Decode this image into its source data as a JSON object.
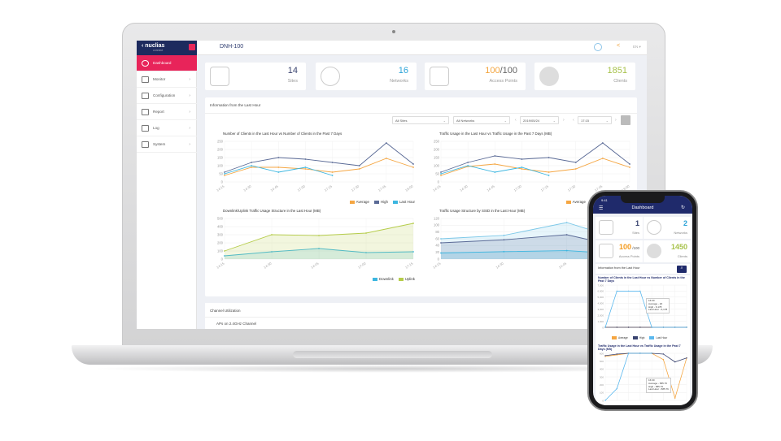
{
  "laptop": {
    "sidebar": {
      "brand": "nuclias",
      "brand_sub": "connect",
      "items": [
        {
          "label": "Dashboard",
          "icon": "dashboard-icon",
          "active": true
        },
        {
          "label": "Monitor",
          "icon": "monitor-icon"
        },
        {
          "label": "Configuration",
          "icon": "tools-icon"
        },
        {
          "label": "Report",
          "icon": "report-icon"
        },
        {
          "label": "Log",
          "icon": "log-icon"
        },
        {
          "label": "System",
          "icon": "system-icon"
        }
      ]
    },
    "header": {
      "device": "DNH-100",
      "lang": "EN ▾"
    },
    "stats": [
      {
        "value": "14",
        "label": "Sites",
        "color": "#3a4470"
      },
      {
        "value": "16",
        "label": "Networks",
        "color": "#2aa3d8"
      },
      {
        "value": "100",
        "total": "/100",
        "label": "Access Points",
        "color": "#f3a53e"
      },
      {
        "value": "1851",
        "label": "Clients",
        "color": "#a7c24a"
      }
    ],
    "panel": {
      "title": "Information from the Last Hour",
      "filters": {
        "site": "All Sites",
        "network": "All Networks",
        "date": "2019/05/24",
        "time": "17:15"
      }
    },
    "channel": {
      "title": "Channel Utilization",
      "subtitle": "APs on 2.4GHz Channel"
    }
  },
  "chart_data": [
    {
      "type": "line",
      "title": "Number of Clients in the Last Hour vs Number of Clients in the Past 7 Days",
      "categories": [
        "14:15",
        "14:30",
        "14:45",
        "17:00",
        "17:15",
        "17:30",
        "17:45",
        "18:00"
      ],
      "ylim": [
        0,
        250
      ],
      "yticks": [
        0,
        50,
        100,
        150,
        200,
        250
      ],
      "grid": true,
      "legend": "bottom-right",
      "series": [
        {
          "name": "Average",
          "color": "#f5a642",
          "values": [
            40,
            90,
            90,
            80,
            60,
            80,
            145,
            90
          ]
        },
        {
          "name": "High",
          "color": "#5a6a96",
          "values": [
            60,
            120,
            150,
            140,
            120,
            100,
            240,
            110
          ]
        },
        {
          "name": "Last Hour",
          "color": "#3cb6e0",
          "values": [
            50,
            100,
            60,
            90,
            40
          ]
        }
      ]
    },
    {
      "type": "line",
      "title": "Traffic Usage in the Last Hour vs Traffic Usage in the Past 7 Days (MB)",
      "categories": [
        "14:15",
        "14:30",
        "14:45",
        "17:00",
        "17:15",
        "17:30",
        "17:45",
        "18:00"
      ],
      "ylim": [
        0,
        250
      ],
      "yticks": [
        0,
        50,
        100,
        150,
        200,
        250
      ],
      "grid": true,
      "legend": "bottom-right",
      "series": [
        {
          "name": "Average",
          "color": "#f5a642",
          "values": [
            40,
            95,
            110,
            80,
            60,
            80,
            145,
            90
          ]
        },
        {
          "name": "High",
          "color": "#5a6a96",
          "values": [
            60,
            120,
            160,
            140,
            150,
            120,
            240,
            110
          ]
        },
        {
          "name": "Last Hour",
          "color": "#3cb6e0",
          "values": [
            50,
            100,
            60,
            90,
            40
          ]
        }
      ]
    },
    {
      "type": "area",
      "title": "Downlink/Uplink Traffic Usage Structure in the Last Hour (MB)",
      "categories": [
        "14:15",
        "14:30",
        "14:45",
        "17:00",
        "17:15"
      ],
      "ylim": [
        0,
        500
      ],
      "yticks": [
        0,
        100,
        200,
        300,
        400,
        500
      ],
      "grid": true,
      "legend": "bottom-right",
      "series": [
        {
          "name": "Downlink",
          "color": "#3cb6e0",
          "values": [
            40,
            90,
            130,
            80,
            90
          ]
        },
        {
          "name": "Uplink",
          "color": "#b5cc4a",
          "values": [
            100,
            300,
            290,
            320,
            440
          ]
        }
      ]
    },
    {
      "type": "area",
      "title": "Traffic Usage Structure by SSID in the Last Hour (MB)",
      "categories": [
        "14:15",
        "14:30",
        "14:45",
        "17:00"
      ],
      "ylim": [
        0,
        120
      ],
      "yticks": [
        0,
        20,
        40,
        60,
        80,
        100,
        120
      ],
      "grid": true,
      "legend": "bottom-right",
      "series": [
        {
          "color": "#7cc8e8",
          "values": [
            60,
            70,
            108,
            50
          ]
        },
        {
          "color": "#5a6a96",
          "values": [
            48,
            57,
            72,
            30
          ]
        },
        {
          "color": "#3cb6e0",
          "values": [
            18,
            22,
            25,
            14
          ]
        }
      ]
    },
    {
      "type": "line",
      "title": "Number of Clients in the Last Hour vs Number of Clients in the Past 7 Days",
      "categories": [
        "",
        "",
        "",
        "",
        "",
        "",
        "",
        ""
      ],
      "ylim": [
        0,
        7000
      ],
      "yticks": [
        0,
        1000,
        2000,
        3000,
        4000,
        5000,
        6000,
        7000
      ],
      "grid": true,
      "legend": "bottom",
      "series": [
        {
          "name": "Average",
          "color": "#f5a642",
          "values": [
            0,
            0,
            0,
            0,
            0,
            0,
            0,
            0
          ]
        },
        {
          "name": "High",
          "color": "#3a4470",
          "values": [
            0,
            0,
            0,
            0,
            0,
            0,
            0,
            0
          ]
        },
        {
          "name": "Last Hour",
          "color": "#5bb8ee",
          "values": [
            0,
            6000,
            6000,
            6000,
            0,
            0,
            0,
            0
          ]
        }
      ],
      "tooltip": [
        "16:00",
        "Average - 20",
        "High - 6,178",
        "Last Hour - 6,178"
      ]
    },
    {
      "type": "line",
      "title": "Traffic Usage in the Last Hour vs Traffic Usage in the Past 7 Days (KB)",
      "categories": [
        "",
        "",
        "",
        "",
        "",
        "",
        "",
        ""
      ],
      "ylim": [
        0,
        600
      ],
      "yticks": [
        0,
        100,
        200,
        300,
        400,
        500,
        600
      ],
      "grid": true,
      "series": [
        {
          "name": "Average",
          "color": "#f5a642",
          "values": [
            560,
            580,
            600,
            600,
            600,
            520,
            30,
            540
          ]
        },
        {
          "name": "High",
          "color": "#3a4470",
          "values": [
            570,
            590,
            600,
            600,
            600,
            590,
            490,
            540
          ]
        },
        {
          "name": "Last Hour",
          "color": "#5bb8ee",
          "values": [
            0,
            150,
            600,
            600,
            600
          ]
        }
      ],
      "tooltip": [
        "16:00",
        "Average - 585.76",
        "High - 585.76",
        "Last Hour - 585.76"
      ]
    }
  ],
  "phone": {
    "time": "9:41",
    "title": "Dashboard",
    "stats": [
      {
        "value": "1",
        "label": "Sites",
        "color": "#3a4470"
      },
      {
        "value": "2",
        "label": "Networks",
        "color": "#2aa3d8"
      },
      {
        "value": "100",
        "total": " /100",
        "label": "Access Points",
        "color": "#f39a1e"
      },
      {
        "value": "1450",
        "label": "Clients",
        "color": "#a7c24a"
      }
    ],
    "info": "Information from the Last Hour"
  }
}
